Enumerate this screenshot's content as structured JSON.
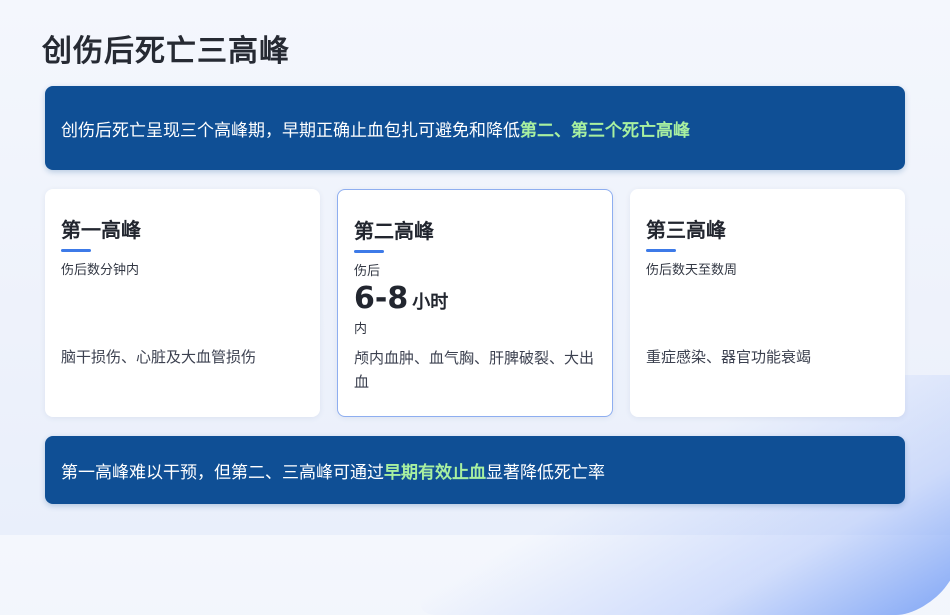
{
  "title": "创伤后死亡三高峰",
  "top_banner": {
    "text": "创伤后死亡呈现三个高峰期，早期正确止血包扎可避免和降低",
    "highlight": "第二、第三个死亡高峰"
  },
  "cards": [
    {
      "title": "第一高峰",
      "time": "伤后数分钟内",
      "desc": "脑干损伤、心脏及大血管损伤"
    },
    {
      "title": "第二高峰",
      "time_prefix": "伤后",
      "time_number": "6-8",
      "time_unit": "小时",
      "time_suffix": "内",
      "desc": "颅内血肿、血气胸、肝脾破裂、大出血"
    },
    {
      "title": "第三高峰",
      "time": "伤后数天至数周",
      "desc": "重症感染、器官功能衰竭"
    }
  ],
  "bottom_banner": {
    "text_before": "第一高峰难以干预，但第二、三高峰可通过",
    "highlight": "早期有效止血",
    "text_after": "显著降低死亡率"
  },
  "colors": {
    "banner_bg": "#0f4f95",
    "highlight": "#a8f0a0",
    "accent": "#3d7ae8"
  }
}
